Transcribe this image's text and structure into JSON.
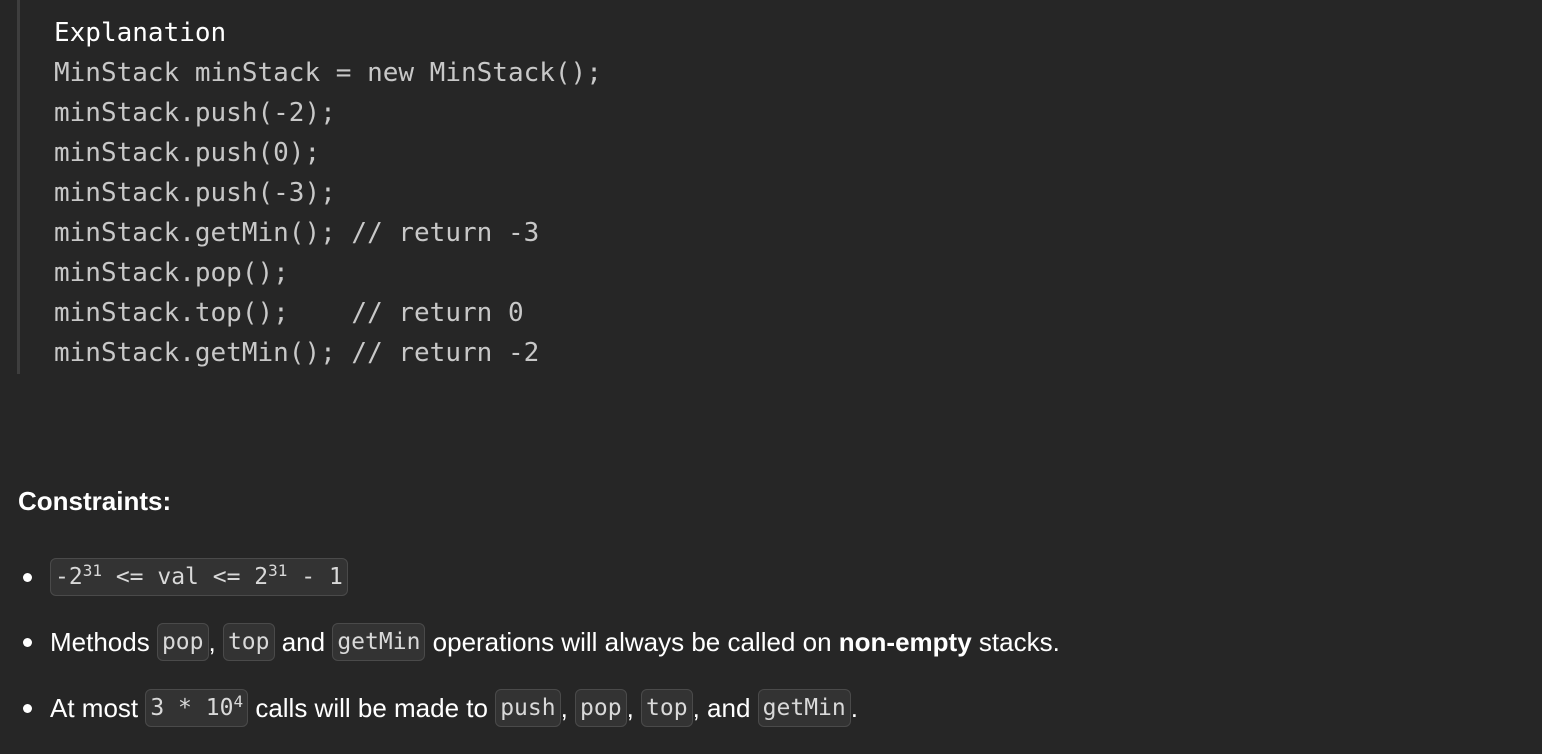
{
  "example": {
    "heading": "Explanation",
    "lines": [
      "MinStack minStack = new MinStack();",
      "minStack.push(-2);",
      "minStack.push(0);",
      "minStack.push(-3);",
      "minStack.getMin(); // return -3",
      "minStack.pop();",
      "minStack.top();    // return 0",
      "minStack.getMin(); // return -2"
    ]
  },
  "constraints": {
    "title": "Constraints:",
    "item1": {
      "neg": "-2",
      "exp1": "31",
      "mid": " <= val <= 2",
      "exp2": "31",
      "end": " - 1"
    },
    "item2": {
      "prefix": "Methods ",
      "code1": "pop",
      "sep1": ", ",
      "code2": "top",
      "sep2": " and ",
      "code3": "getMin",
      "mid": " operations will always be called on ",
      "bold": "non-empty",
      "suffix": " stacks."
    },
    "item3": {
      "prefix": "At most ",
      "code_base": "3 * 10",
      "code_exp": "4",
      "mid": " calls will be made to ",
      "code1": "push",
      "sep1": ", ",
      "code2": "pop",
      "sep2": ", ",
      "code3": "top",
      "sep3": ", and ",
      "code4": "getMin",
      "suffix": "."
    }
  }
}
